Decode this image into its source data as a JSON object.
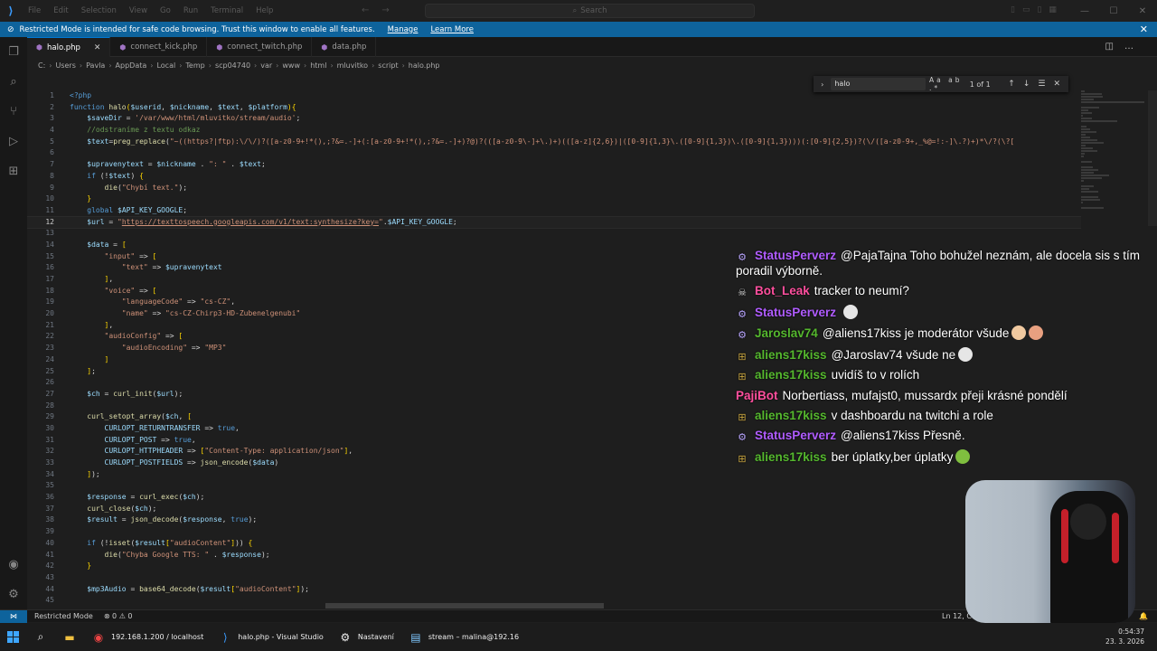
{
  "titlebar": {
    "menu": [
      "File",
      "Edit",
      "Selection",
      "View",
      "Go",
      "Run",
      "Terminal",
      "Help"
    ],
    "search_placeholder": "Search"
  },
  "banner": {
    "text": "Restricted Mode is intended for safe code browsing. Trust this window to enable all features.",
    "manage": "Manage",
    "learn_more": "Learn More"
  },
  "tabs": [
    {
      "label": "halo.php",
      "active": true
    },
    {
      "label": "connect_kick.php",
      "active": false
    },
    {
      "label": "connect_twitch.php",
      "active": false
    },
    {
      "label": "data.php",
      "active": false
    }
  ],
  "breadcrumb": [
    "C:",
    "Users",
    "Pavla",
    "AppData",
    "Local",
    "Temp",
    "scp04740",
    "var",
    "www",
    "html",
    "mluvitko",
    "script",
    "halo.php"
  ],
  "find": {
    "query": "halo",
    "options": "Aa ab .*",
    "count": "1 of 1"
  },
  "editor": {
    "current_line": 12,
    "lines": [
      {
        "n": "1",
        "html": "<span class=\"php\">&lt;?php</span>"
      },
      {
        "n": "2",
        "html": "<span class=\"kw\">function</span> <span class=\"fn\">halo</span><span class=\"brk\">(</span><span class=\"var\">$userid</span>, <span class=\"var\">$nickname</span>, <span class=\"var\">$text</span>, <span class=\"var\">$platform</span><span class=\"brk\">){</span>"
      },
      {
        "n": "3",
        "html": "    <span class=\"var\">$saveDir</span> = <span class=\"str\">'/var/www/html/mluvitko/stream/audio'</span>;"
      },
      {
        "n": "4",
        "html": "    <span class=\"com\">//odstraníme z textu odkaz</span>"
      },
      {
        "n": "5",
        "html": "    <span class=\"var\">$text</span>=<span class=\"fn\">preg_replace</span>(<span class=\"str\">\"~((https?|ftp):\\/\\/)?([a-z0-9+!*(),;?&amp;=.-]+(:[a-z0-9+!*(),;?&amp;=.-]+)?@)?(([a-z0-9\\-]+\\.)+)(([a-z]{2,6})|([0-9]{1,3}\\.([0-9]{1,3})\\.([0-9]{1,3})))(:[0-9]{2,5})?(\\/([a-z0-9+,_%@=!:-]\\.?)+)*\\/?(\\?[</span>"
      },
      {
        "n": "6",
        "html": ""
      },
      {
        "n": "7",
        "html": "    <span class=\"var\">$upravenytext</span> = <span class=\"var\">$nickname</span> . <span class=\"str\">\": \"</span> . <span class=\"var\">$text</span>;"
      },
      {
        "n": "8",
        "html": "    <span class=\"kw\">if</span> (!<span class=\"var\">$text</span>) <span class=\"brk\">{</span>"
      },
      {
        "n": "9",
        "html": "        <span class=\"fn\">die</span>(<span class=\"str\">\"Chybí text.\"</span>);"
      },
      {
        "n": "10",
        "html": "    <span class=\"brk\">}</span>"
      },
      {
        "n": "11",
        "html": "    <span class=\"kw\">global</span> <span class=\"var\">$API_KEY_GOOGLE</span>;"
      },
      {
        "n": "12",
        "html": "    <span class=\"var\">$url</span> = <span class=\"str\">\"<u>https://texttospeech.googleapis.com/v1/text:synthesize?key=</u>\"</span>.<span class=\"var\">$API_KEY_GOOGLE</span>;"
      },
      {
        "n": "13",
        "html": ""
      },
      {
        "n": "14",
        "html": "    <span class=\"var\">$data</span> = <span class=\"brk\">[</span>"
      },
      {
        "n": "15",
        "html": "        <span class=\"str\">\"input\"</span> =&gt; <span class=\"brk\">[</span>"
      },
      {
        "n": "16",
        "html": "            <span class=\"str\">\"text\"</span> =&gt; <span class=\"var\">$upravenytext</span>"
      },
      {
        "n": "17",
        "html": "        <span class=\"brk\">]</span>,"
      },
      {
        "n": "18",
        "html": "        <span class=\"str\">\"voice\"</span> =&gt; <span class=\"brk\">[</span>"
      },
      {
        "n": "19",
        "html": "            <span class=\"str\">\"languageCode\"</span> =&gt; <span class=\"str\">\"cs-CZ\"</span>,"
      },
      {
        "n": "20",
        "html": "            <span class=\"str\">\"name\"</span> =&gt; <span class=\"str\">\"cs-CZ-Chirp3-HD-Zubenelgenubi\"</span>"
      },
      {
        "n": "21",
        "html": "        <span class=\"brk\">]</span>,"
      },
      {
        "n": "22",
        "html": "        <span class=\"str\">\"audioConfig\"</span> =&gt; <span class=\"brk\">[</span>"
      },
      {
        "n": "23",
        "html": "            <span class=\"str\">\"audioEncoding\"</span> =&gt; <span class=\"str\">\"MP3\"</span>"
      },
      {
        "n": "24",
        "html": "        <span class=\"brk\">]</span>"
      },
      {
        "n": "25",
        "html": "    <span class=\"brk\">]</span>;"
      },
      {
        "n": "26",
        "html": ""
      },
      {
        "n": "27",
        "html": "    <span class=\"var\">$ch</span> = <span class=\"fn\">curl_init</span>(<span class=\"var\">$url</span>);"
      },
      {
        "n": "28",
        "html": ""
      },
      {
        "n": "29",
        "html": "    <span class=\"fn\">curl_setopt_array</span>(<span class=\"var\">$ch</span>, <span class=\"brk\">[</span>"
      },
      {
        "n": "30",
        "html": "        <span class=\"var\">CURLOPT_RETURNTRANSFER</span> =&gt; <span class=\"kw\">true</span>,"
      },
      {
        "n": "31",
        "html": "        <span class=\"var\">CURLOPT_POST</span> =&gt; <span class=\"kw\">true</span>,"
      },
      {
        "n": "32",
        "html": "        <span class=\"var\">CURLOPT_HTTPHEADER</span> =&gt; <span class=\"brk\">[</span><span class=\"str\">\"Content-Type: application/json\"</span><span class=\"brk\">]</span>,"
      },
      {
        "n": "33",
        "html": "        <span class=\"var\">CURLOPT_POSTFIELDS</span> =&gt; <span class=\"fn\">json_encode</span>(<span class=\"var\">$data</span>)"
      },
      {
        "n": "34",
        "html": "    <span class=\"brk\">]</span>);"
      },
      {
        "n": "35",
        "html": ""
      },
      {
        "n": "36",
        "html": "    <span class=\"var\">$response</span> = <span class=\"fn\">curl_exec</span>(<span class=\"var\">$ch</span>);"
      },
      {
        "n": "37",
        "html": "    <span class=\"fn\">curl_close</span>(<span class=\"var\">$ch</span>);"
      },
      {
        "n": "38",
        "html": "    <span class=\"var\">$result</span> = <span class=\"fn\">json_decode</span>(<span class=\"var\">$response</span>, <span class=\"kw\">true</span>);"
      },
      {
        "n": "39",
        "html": ""
      },
      {
        "n": "40",
        "html": "    <span class=\"kw\">if</span> (!<span class=\"fn\">isset</span>(<span class=\"var\">$result</span><span class=\"brk\">[</span><span class=\"str\">\"audioContent\"</span><span class=\"brk\">]</span>)) <span class=\"brk\">{</span>"
      },
      {
        "n": "41",
        "html": "        <span class=\"fn\">die</span>(<span class=\"str\">\"Chyba Google TTS: \"</span> . <span class=\"var\">$response</span>);"
      },
      {
        "n": "42",
        "html": "    <span class=\"brk\">}</span>"
      },
      {
        "n": "43",
        "html": ""
      },
      {
        "n": "44",
        "html": "    <span class=\"var\">$mp3Audio</span> = <span class=\"fn\">base64_decode</span>(<span class=\"var\">$result</span><span class=\"brk\">[</span><span class=\"str\">\"audioContent\"</span><span class=\"brk\">]</span>);"
      },
      {
        "n": "45",
        "html": ""
      }
    ]
  },
  "statusbar": {
    "restricted": "Restricted Mode",
    "problems": "⊗ 0 ⚠ 0",
    "position": "Ln 12, C"
  },
  "chat": [
    {
      "user": "StatusPerverz",
      "color": "#b05cff",
      "badge": "gear",
      "text": "@PajaTajna Toho bohužel neznám, ale docela sis s tím poradil výborně."
    },
    {
      "user": "Bot_Leak",
      "color": "#ff4f9e",
      "badge": "skull",
      "text": "tracker to neumí?"
    },
    {
      "user": "StatusPerverz",
      "color": "#b05cff",
      "badge": "gear",
      "text": "",
      "emote": "#e6e6e6"
    },
    {
      "user": "Jaroslav74",
      "color": "#55b82e",
      "badge": "gear",
      "text": "@aliens17kiss je moderátor všude",
      "emote": "#f0c9a0",
      "emote2": "#e8a080"
    },
    {
      "user": "aliens17kiss",
      "color": "#55b82e",
      "badge": "sub",
      "text": "@Jaroslav74 všude ne",
      "emote": "#e6e6e6"
    },
    {
      "user": "aliens17kiss",
      "color": "#55b82e",
      "badge": "sub",
      "text": "uvidíš to v rolích"
    },
    {
      "user": "PajiBot",
      "color": "#ff4f9e",
      "badge": "",
      "text": "Norbertiass, mufajst0, mussardx přeji krásné pondělí"
    },
    {
      "user": "aliens17kiss",
      "color": "#55b82e",
      "badge": "sub",
      "text": "v dashboardu na twitchi a role"
    },
    {
      "user": "StatusPerverz",
      "color": "#b05cff",
      "badge": "gear",
      "text": "@aliens17kiss Přesně."
    },
    {
      "user": "aliens17kiss",
      "color": "#55b82e",
      "badge": "sub",
      "text": "ber úplatky,ber úplatky",
      "emote": "#7fbf3f"
    }
  ],
  "taskbar": {
    "items": [
      {
        "label": "192.168.1.200 / localhost",
        "icon": "chrome-icon"
      },
      {
        "label": "halo.php - Visual Studio",
        "icon": "vscode-icon"
      },
      {
        "label": "Nastavení",
        "icon": "settings-icon"
      },
      {
        "label": "stream – malina@192.16",
        "icon": "terminal-icon"
      }
    ],
    "time": "0:54:37",
    "date": "23. 3. 2026"
  },
  "colors": {
    "accent": "#0078d4",
    "banner": "#0e639c"
  }
}
